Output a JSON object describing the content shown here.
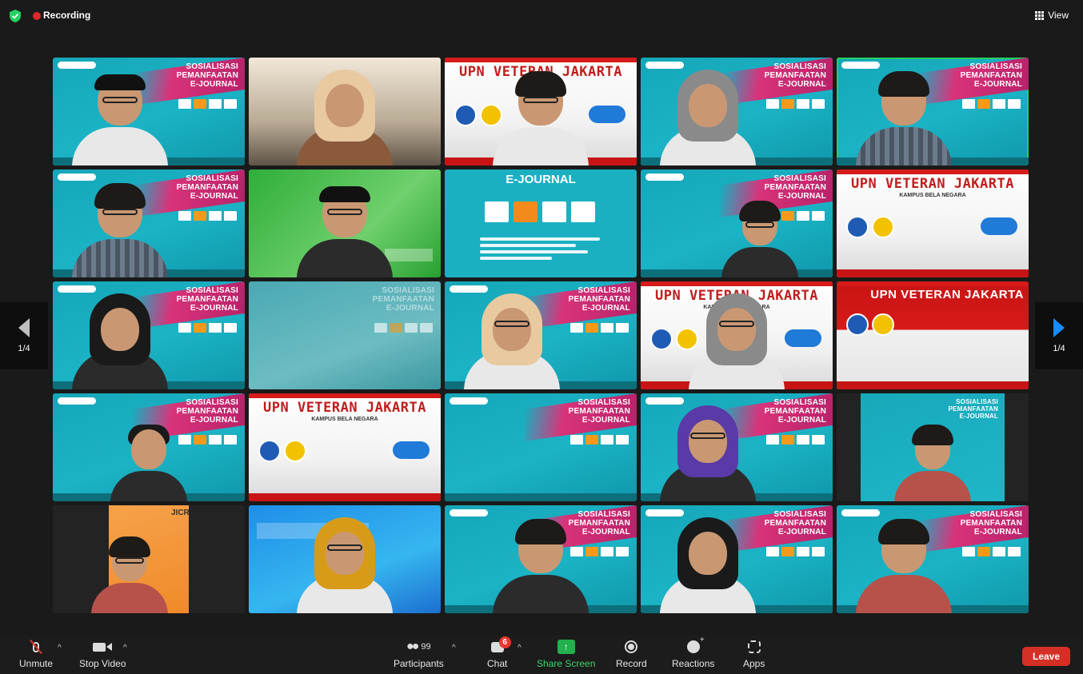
{
  "topbar": {
    "recording_label": "Recording",
    "view_label": "View",
    "icons": [
      "security-shield-icon",
      "recording-dot-icon",
      "grid-view-icon"
    ]
  },
  "gallery": {
    "page_indicator_left": "1/4",
    "page_indicator_right": "1/4",
    "slide_texts": {
      "sosialisasi": "SOSIALISASI",
      "pemanfaatan": "PEMANFAATAN",
      "ejournal": "E-JOURNAL",
      "upn": "UPN VETERAN JAKARTA",
      "kampus": "KAMPUS BELA NEGARA",
      "jicr": "JICR"
    },
    "tiles": [
      {
        "id": 1,
        "background": "slide"
      },
      {
        "id": 2,
        "background": "office"
      },
      {
        "id": 3,
        "background": "upn"
      },
      {
        "id": 4,
        "background": "slide"
      },
      {
        "id": 5,
        "background": "slide",
        "active_speaker": true
      },
      {
        "id": 6,
        "background": "slide"
      },
      {
        "id": 7,
        "background": "green"
      },
      {
        "id": 8,
        "background": "ejournal"
      },
      {
        "id": 9,
        "background": "slide"
      },
      {
        "id": 10,
        "background": "upn"
      },
      {
        "id": 11,
        "background": "slide"
      },
      {
        "id": 12,
        "background": "blurred-slide"
      },
      {
        "id": 13,
        "background": "slide"
      },
      {
        "id": 14,
        "background": "upn"
      },
      {
        "id": 15,
        "background": "upn-red"
      },
      {
        "id": 16,
        "background": "slide"
      },
      {
        "id": 17,
        "background": "upn"
      },
      {
        "id": 18,
        "background": "slide"
      },
      {
        "id": 19,
        "background": "slide"
      },
      {
        "id": 20,
        "background": "dark-with-slide-inset"
      },
      {
        "id": 21,
        "background": "dark-with-orange-inset"
      },
      {
        "id": 22,
        "background": "blue-siap"
      },
      {
        "id": 23,
        "background": "slide"
      },
      {
        "id": 24,
        "background": "slide"
      },
      {
        "id": 25,
        "background": "slide"
      }
    ]
  },
  "toolbar": {
    "unmute_label": "Unmute",
    "stop_video_label": "Stop Video",
    "participants_label": "Participants",
    "participants_count": "99",
    "chat_label": "Chat",
    "chat_badge": "6",
    "share_label": "Share Screen",
    "record_label": "Record",
    "reactions_label": "Reactions",
    "apps_label": "Apps",
    "leave_label": "Leave",
    "colors": {
      "share_accent": "#22b14c",
      "leave_bg": "#d42f25",
      "active_speaker_border": "#23d160",
      "page_arrow_active": "#1a8cff",
      "recording_dot": "#e02828"
    }
  }
}
